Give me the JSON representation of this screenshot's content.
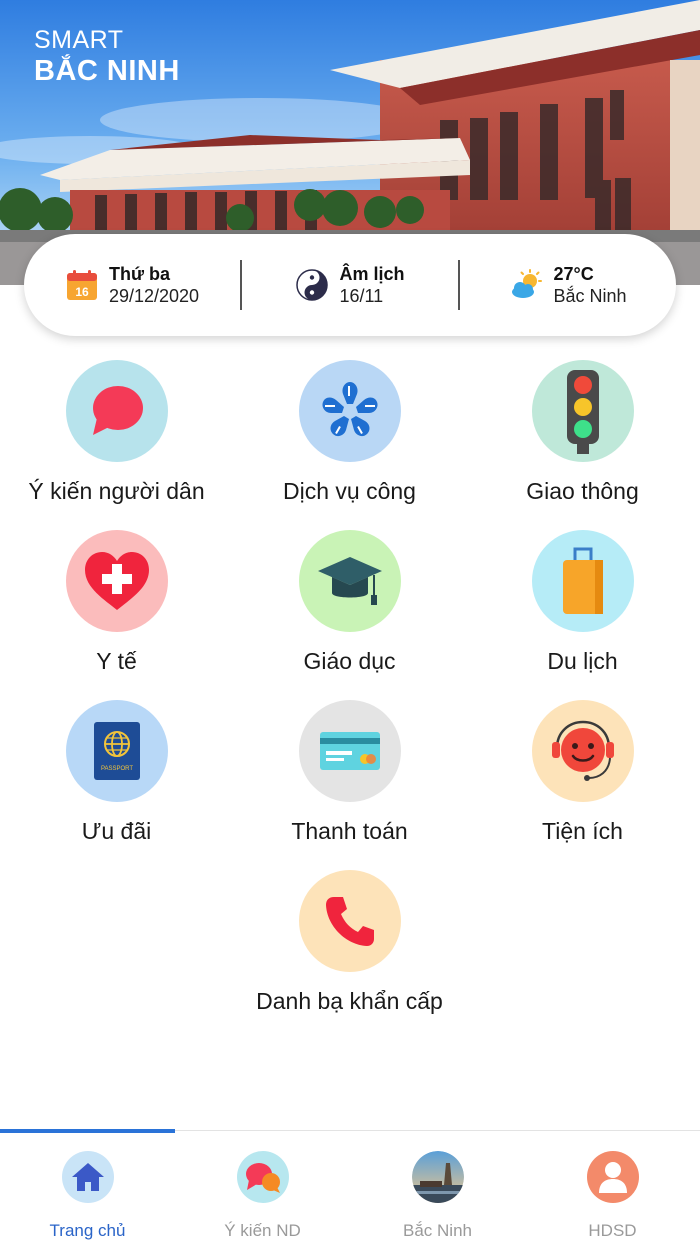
{
  "header": {
    "brand_top": "SMART",
    "brand_bottom": "BẮC NINH"
  },
  "info": {
    "date": {
      "icon": "calendar-icon",
      "day_number": "16",
      "title": "Thứ ba",
      "value": "29/12/2020"
    },
    "lunar": {
      "icon": "yin-yang-icon",
      "title": "Âm lịch",
      "value": "16/11"
    },
    "weather": {
      "icon": "partly-cloudy-icon",
      "title": "27°C",
      "value": "Bắc Ninh"
    }
  },
  "grid": [
    {
      "label": "Ý kiến người dân",
      "icon": "speech-bubble-icon",
      "bg": "#b7e3ec"
    },
    {
      "label": "Dịch vụ công",
      "icon": "hands-star-icon",
      "bg": "#b9d7f5"
    },
    {
      "label": "Giao thông",
      "icon": "traffic-light-icon",
      "bg": "#bfe8d9"
    },
    {
      "label": "Y tế",
      "icon": "medical-heart-icon",
      "bg": "#fbbcbc"
    },
    {
      "label": "Giáo dục",
      "icon": "graduation-cap-icon",
      "bg": "#c9f3b6"
    },
    {
      "label": "Du lịch",
      "icon": "luggage-icon",
      "bg": "#b6ecf7"
    },
    {
      "label": "Ưu đãi",
      "icon": "passport-icon",
      "bg": "#b8d8f7"
    },
    {
      "label": "Thanh toán",
      "icon": "credit-card-icon",
      "bg": "#e4e4e4"
    },
    {
      "label": "Tiện ích",
      "icon": "support-agent-icon",
      "bg": "#fde3b9"
    },
    {
      "label": "Danh bạ khẩn cấp",
      "icon": "phone-icon",
      "bg": "#fde3b9"
    }
  ],
  "passport_text": "PASSPORT",
  "nav": [
    {
      "label": "Trang chủ",
      "icon": "home-icon",
      "active": true
    },
    {
      "label": "Ý kiến ND",
      "icon": "chat-bubbles-icon",
      "active": false
    },
    {
      "label": "Bắc Ninh",
      "icon": "landmark-photo-icon",
      "active": false
    },
    {
      "label": "HDSD",
      "icon": "user-guide-icon",
      "active": false
    }
  ],
  "colors": {
    "accent": "#2a64c8",
    "indicator": "#2a73d8",
    "red": "#f03a53"
  }
}
